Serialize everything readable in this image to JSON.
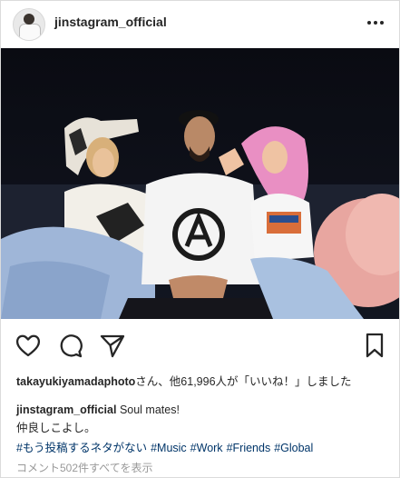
{
  "post": {
    "username": "jinstagram_official",
    "likes": {
      "first_liker": "takayukiyamadaphoto",
      "rest": "さん、他61,996人が「いいね！」しました"
    },
    "caption": {
      "author": "jinstagram_official",
      "line1": "Soul mates!",
      "line2": "仲良しこよし。"
    },
    "hashtags": [
      "#もう投稿するネタがない",
      "#Music",
      "#Work",
      "#Friends",
      "#Global"
    ],
    "view_comments": "コメント502件すべてを表示"
  },
  "icons": {
    "avatar": "profile-avatar",
    "more": "more-options-icon",
    "like": "heart-icon",
    "comment": "comment-icon",
    "share": "paper-plane-icon",
    "save": "bookmark-icon"
  },
  "colors": {
    "text": "#262626",
    "hashtag": "#003569",
    "muted": "#999999",
    "border": "#dbdbdb"
  }
}
